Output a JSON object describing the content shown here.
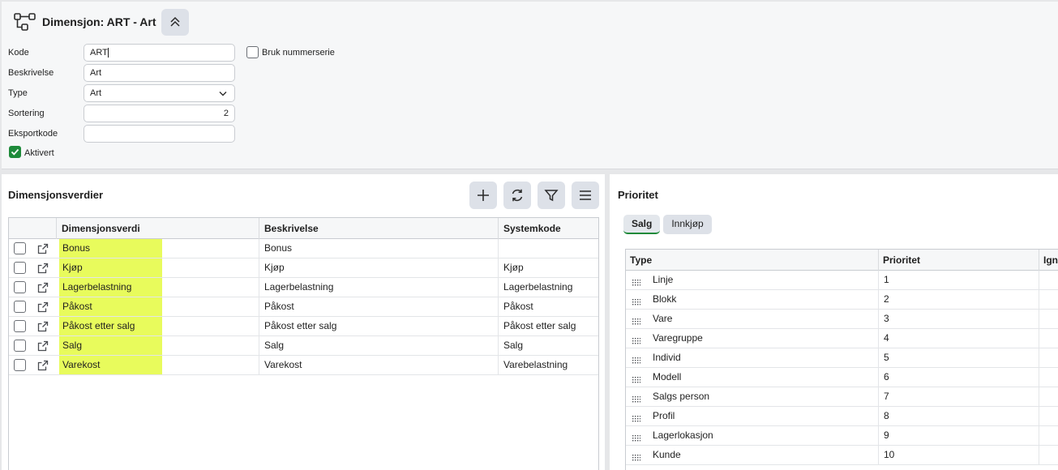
{
  "header": {
    "title": "Dimensjon: ART - Art"
  },
  "form": {
    "kode_label": "Kode",
    "kode_value": "ART",
    "bruk_nummerserie_label": "Bruk nummerserie",
    "beskrivelse_label": "Beskrivelse",
    "beskrivelse_value": "Art",
    "type_label": "Type",
    "type_value": "Art",
    "sortering_label": "Sortering",
    "sortering_value": "2",
    "eksportkode_label": "Eksportkode",
    "eksportkode_value": "",
    "aktivert_label": "Aktivert",
    "aktivert_checked": true
  },
  "left_panel": {
    "title": "Dimensjonsverdier",
    "columns": [
      "Dimensjonsverdi",
      "Beskrivelse",
      "Systemkode"
    ],
    "rows": [
      [
        "Bonus",
        "Bonus",
        ""
      ],
      [
        "Kjøp",
        "Kjøp",
        "Kjøp"
      ],
      [
        "Lagerbelastning",
        "Lagerbelastning",
        "Lagerbelastning"
      ],
      [
        "Påkost",
        "Påkost",
        "Påkost"
      ],
      [
        "Påkost etter salg",
        "Påkost etter salg",
        "Påkost etter salg"
      ],
      [
        "Salg",
        "Salg",
        "Salg"
      ],
      [
        "Varekost",
        "Varekost",
        "Varebelastning"
      ]
    ],
    "highlight_color": "#e8fb5c"
  },
  "right_panel": {
    "title": "Prioritet",
    "tabs": [
      "Salg",
      "Innkjøp"
    ],
    "active_tab": "Salg",
    "columns": [
      "Type",
      "Prioritet",
      "Ign"
    ],
    "rows": [
      [
        "Linje",
        "1"
      ],
      [
        "Blokk",
        "2"
      ],
      [
        "Vare",
        "3"
      ],
      [
        "Varegruppe",
        "4"
      ],
      [
        "Individ",
        "5"
      ],
      [
        "Modell",
        "6"
      ],
      [
        "Salgs person",
        "7"
      ],
      [
        "Profil",
        "8"
      ],
      [
        "Lagerlokasjon",
        "9"
      ],
      [
        "Kunde",
        "10"
      ]
    ]
  },
  "colors": {
    "accent": "#1e8a3a",
    "button_bg": "#dde1e8"
  }
}
